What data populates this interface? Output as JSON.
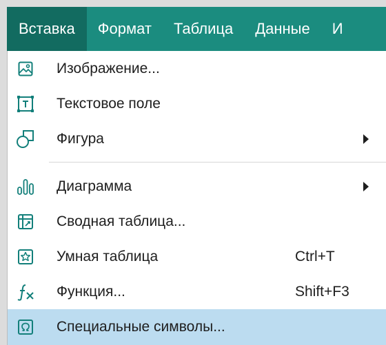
{
  "menubar": {
    "items": [
      {
        "label": "Вставка"
      },
      {
        "label": "Формат"
      },
      {
        "label": "Таблица"
      },
      {
        "label": "Данные"
      },
      {
        "label": "И"
      }
    ]
  },
  "menu": {
    "items": [
      {
        "label": "Изображение...",
        "icon": "image-icon"
      },
      {
        "label": "Текстовое поле",
        "icon": "text-box-icon"
      },
      {
        "label": "Фигура",
        "icon": "shapes-icon",
        "submenu": true
      },
      {
        "label": "Диаграмма",
        "icon": "chart-icon",
        "submenu": true
      },
      {
        "label": "Сводная таблица...",
        "icon": "pivot-table-icon"
      },
      {
        "label": "Умная таблица",
        "icon": "smart-table-icon",
        "shortcut": "Ctrl+T"
      },
      {
        "label": "Функция...",
        "icon": "function-icon",
        "shortcut": "Shift+F3"
      },
      {
        "label": "Специальные символы...",
        "icon": "omega-icon",
        "highlighted": true
      }
    ]
  },
  "colors": {
    "menubar_background": "#1b8c7f",
    "active_menu_background": "#126b60",
    "highlight_background": "#bcdcf0",
    "icon_color": "#127f7a"
  }
}
